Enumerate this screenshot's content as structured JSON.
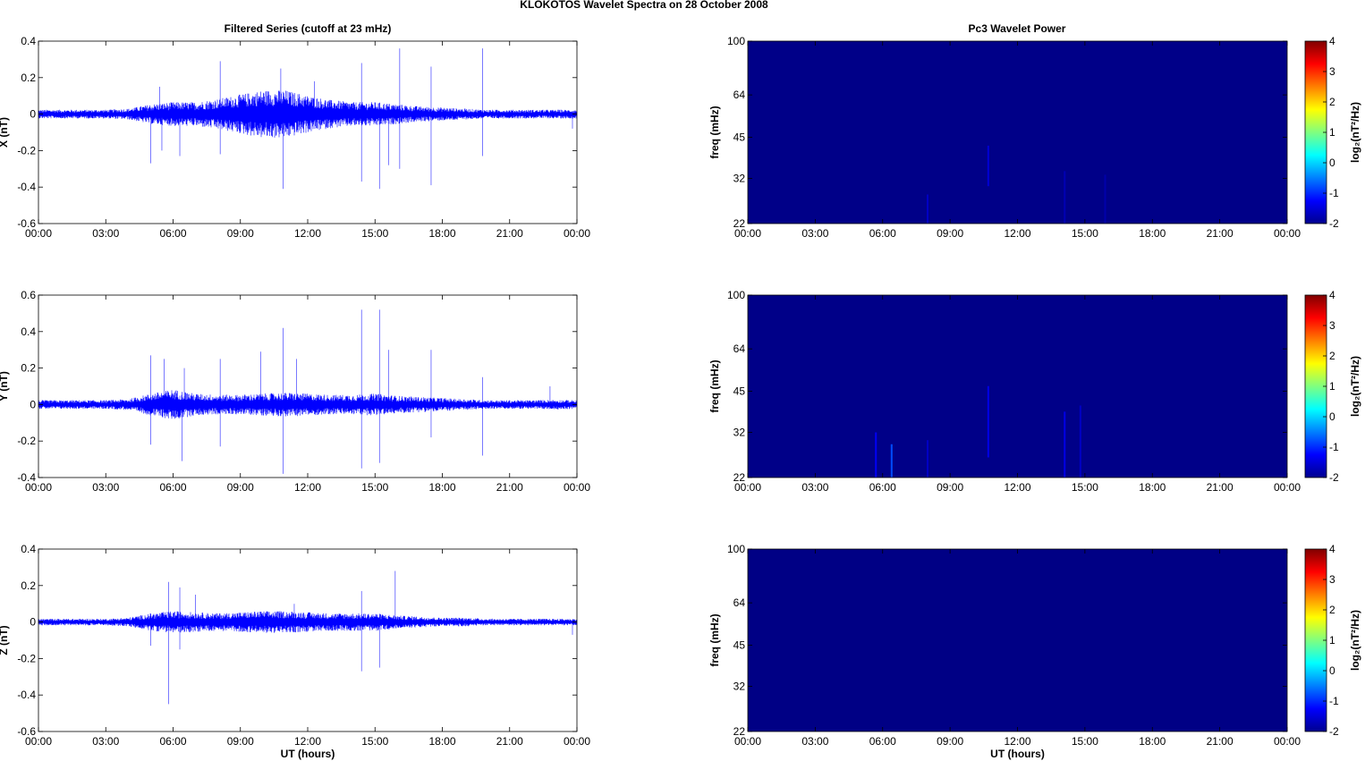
{
  "figure_title": "KLOKOTOS Wavelet Spectra on 28 October   2008",
  "left_title": "Filtered Series (cutoff at 23 mHz)",
  "right_title": "Pc3 Wavelet Power",
  "colors": {
    "line": "#0000ff",
    "heat_background": "#00008f",
    "axis": "#000000"
  },
  "chart_data": [
    {
      "type": "line",
      "id": "x-series",
      "ylabel": "X (nT)",
      "xlabel": "",
      "xlim": [
        0,
        24
      ],
      "ylim": [
        -0.6,
        0.4
      ],
      "yticks": [
        "0.4",
        "0.2",
        "0",
        "-0.2",
        "-0.4",
        "-0.6"
      ],
      "ytick_values": [
        0.4,
        0.2,
        0,
        -0.2,
        -0.4,
        -0.6
      ],
      "xticks": [
        "00:00",
        "03:00",
        "06:00",
        "09:00",
        "12:00",
        "15:00",
        "18:00",
        "21:00",
        "00:00"
      ],
      "envelope_hourly": [
        0.02,
        0.02,
        0.02,
        0.02,
        0.025,
        0.045,
        0.055,
        0.055,
        0.07,
        0.09,
        0.11,
        0.11,
        0.085,
        0.065,
        0.055,
        0.055,
        0.045,
        0.035,
        0.03,
        0.025,
        0.02,
        0.02,
        0.02,
        0.02,
        0.02
      ],
      "spikes": [
        [
          5.0,
          -0.27
        ],
        [
          5.4,
          0.15
        ],
        [
          5.5,
          -0.2
        ],
        [
          6.3,
          -0.23
        ],
        [
          8.1,
          0.29
        ],
        [
          8.1,
          -0.22
        ],
        [
          10.8,
          0.25
        ],
        [
          10.9,
          -0.41
        ],
        [
          12.3,
          0.18
        ],
        [
          14.4,
          0.28
        ],
        [
          14.4,
          -0.37
        ],
        [
          15.2,
          -0.41
        ],
        [
          15.6,
          -0.28
        ],
        [
          16.1,
          0.36
        ],
        [
          16.1,
          -0.3
        ],
        [
          17.5,
          0.26
        ],
        [
          17.5,
          -0.39
        ],
        [
          19.8,
          0.36
        ],
        [
          19.8,
          -0.23
        ],
        [
          23.8,
          -0.08
        ]
      ]
    },
    {
      "type": "heatmap",
      "id": "x-wavelet",
      "ylabel": "freq (mHz)",
      "xlim": [
        0,
        24
      ],
      "ylim": [
        22,
        100
      ],
      "yscale": "log",
      "yticks": [
        "100",
        "64",
        "45",
        "32",
        "22"
      ],
      "ytick_values": [
        100,
        64,
        45,
        32,
        22
      ],
      "xticks": [
        "00:00",
        "03:00",
        "06:00",
        "09:00",
        "12:00",
        "15:00",
        "18:00",
        "21:00",
        "00:00"
      ],
      "background_level": -1.95,
      "streaks": [
        [
          8.0,
          22,
          28,
          -1.6
        ],
        [
          10.7,
          30,
          42,
          -1.5
        ],
        [
          14.1,
          22,
          34,
          -1.7
        ],
        [
          15.9,
          22,
          33,
          -1.75
        ]
      ],
      "colorbar": {
        "label": "log₂(nT²/Hz)",
        "ticks": [
          "4",
          "3",
          "2",
          "1",
          "0",
          "-1",
          "-2"
        ],
        "tick_values": [
          4,
          3,
          2,
          1,
          0,
          -1,
          -2
        ],
        "range": [
          -2,
          4
        ]
      }
    },
    {
      "type": "line",
      "id": "y-series",
      "ylabel": "Y (nT)",
      "xlabel": "",
      "xlim": [
        0,
        24
      ],
      "ylim": [
        -0.4,
        0.6
      ],
      "yticks": [
        "0.6",
        "0.4",
        "0.2",
        "0",
        "-0.2",
        "-0.4"
      ],
      "ytick_values": [
        0.6,
        0.4,
        0.2,
        0,
        -0.2,
        -0.4
      ],
      "xticks": [
        "00:00",
        "03:00",
        "06:00",
        "09:00",
        "12:00",
        "15:00",
        "18:00",
        "21:00",
        "00:00"
      ],
      "envelope_hourly": [
        0.02,
        0.02,
        0.02,
        0.02,
        0.025,
        0.05,
        0.07,
        0.05,
        0.045,
        0.045,
        0.05,
        0.055,
        0.05,
        0.045,
        0.045,
        0.05,
        0.04,
        0.035,
        0.03,
        0.025,
        0.02,
        0.02,
        0.02,
        0.022,
        0.02
      ],
      "spikes": [
        [
          5.0,
          0.27
        ],
        [
          5.0,
          -0.22
        ],
        [
          5.6,
          0.25
        ],
        [
          6.4,
          -0.31
        ],
        [
          6.5,
          0.2
        ],
        [
          8.1,
          0.25
        ],
        [
          8.1,
          -0.23
        ],
        [
          9.9,
          0.29
        ],
        [
          10.9,
          0.42
        ],
        [
          10.9,
          -0.38
        ],
        [
          11.5,
          0.25
        ],
        [
          14.4,
          0.52
        ],
        [
          14.4,
          -0.35
        ],
        [
          15.2,
          0.52
        ],
        [
          15.2,
          -0.32
        ],
        [
          15.6,
          0.3
        ],
        [
          17.5,
          0.3
        ],
        [
          17.5,
          -0.18
        ],
        [
          19.8,
          0.15
        ],
        [
          19.8,
          -0.28
        ],
        [
          22.8,
          0.1
        ]
      ]
    },
    {
      "type": "heatmap",
      "id": "y-wavelet",
      "ylabel": "freq (mHz)",
      "xlim": [
        0,
        24
      ],
      "ylim": [
        22,
        100
      ],
      "yscale": "log",
      "yticks": [
        "100",
        "64",
        "45",
        "32",
        "22"
      ],
      "ytick_values": [
        100,
        64,
        45,
        32,
        22
      ],
      "xticks": [
        "00:00",
        "03:00",
        "06:00",
        "09:00",
        "12:00",
        "15:00",
        "18:00",
        "21:00",
        "00:00"
      ],
      "background_level": -1.95,
      "streaks": [
        [
          5.7,
          22,
          32,
          -1.3
        ],
        [
          6.4,
          22,
          29,
          -0.8
        ],
        [
          8.0,
          22,
          30,
          -1.6
        ],
        [
          10.7,
          26,
          47,
          -1.4
        ],
        [
          14.1,
          22,
          38,
          -1.4
        ],
        [
          14.8,
          22,
          40,
          -1.6
        ]
      ],
      "colorbar": {
        "label": "log₂(nT²/Hz)",
        "ticks": [
          "4",
          "3",
          "2",
          "1",
          "0",
          "-1",
          "-2"
        ],
        "tick_values": [
          4,
          3,
          2,
          1,
          0,
          -1,
          -2
        ],
        "range": [
          -2,
          4
        ]
      }
    },
    {
      "type": "line",
      "id": "z-series",
      "ylabel": "Z (nT)",
      "xlabel": "UT (hours)",
      "xlim": [
        0,
        24
      ],
      "ylim": [
        -0.6,
        0.4
      ],
      "yticks": [
        "0.4",
        "0.2",
        "0",
        "-0.2",
        "-0.4",
        "-0.6"
      ],
      "ytick_values": [
        0.4,
        0.2,
        0,
        -0.2,
        -0.4,
        -0.6
      ],
      "xticks": [
        "00:00",
        "03:00",
        "06:00",
        "09:00",
        "12:00",
        "15:00",
        "18:00",
        "21:00",
        "00:00"
      ],
      "envelope_hourly": [
        0.015,
        0.015,
        0.015,
        0.015,
        0.02,
        0.04,
        0.05,
        0.045,
        0.04,
        0.045,
        0.05,
        0.05,
        0.045,
        0.04,
        0.04,
        0.04,
        0.03,
        0.025,
        0.02,
        0.02,
        0.015,
        0.015,
        0.015,
        0.015,
        0.015
      ],
      "spikes": [
        [
          5.0,
          -0.13
        ],
        [
          5.8,
          0.22
        ],
        [
          5.8,
          -0.45
        ],
        [
          6.3,
          0.19
        ],
        [
          6.3,
          -0.15
        ],
        [
          7.0,
          0.15
        ],
        [
          11.4,
          0.1
        ],
        [
          14.4,
          0.17
        ],
        [
          14.4,
          -0.27
        ],
        [
          15.2,
          -0.25
        ],
        [
          15.9,
          0.28
        ],
        [
          23.8,
          -0.07
        ]
      ]
    },
    {
      "type": "heatmap",
      "id": "z-wavelet",
      "ylabel": "freq (mHz)",
      "xlabel": "UT (hours)",
      "xlim": [
        0,
        24
      ],
      "ylim": [
        22,
        100
      ],
      "yscale": "log",
      "yticks": [
        "100",
        "64",
        "45",
        "32",
        "22"
      ],
      "ytick_values": [
        100,
        64,
        45,
        32,
        22
      ],
      "xticks": [
        "00:00",
        "03:00",
        "06:00",
        "09:00",
        "12:00",
        "15:00",
        "18:00",
        "21:00",
        "00:00"
      ],
      "background_level": -1.97,
      "streaks": [],
      "colorbar": {
        "label": "log₂(nT²/Hz)",
        "ticks": [
          "4",
          "3",
          "2",
          "1",
          "0",
          "-1",
          "-2"
        ],
        "tick_values": [
          4,
          3,
          2,
          1,
          0,
          -1,
          -2
        ],
        "range": [
          -2,
          4
        ]
      }
    }
  ]
}
